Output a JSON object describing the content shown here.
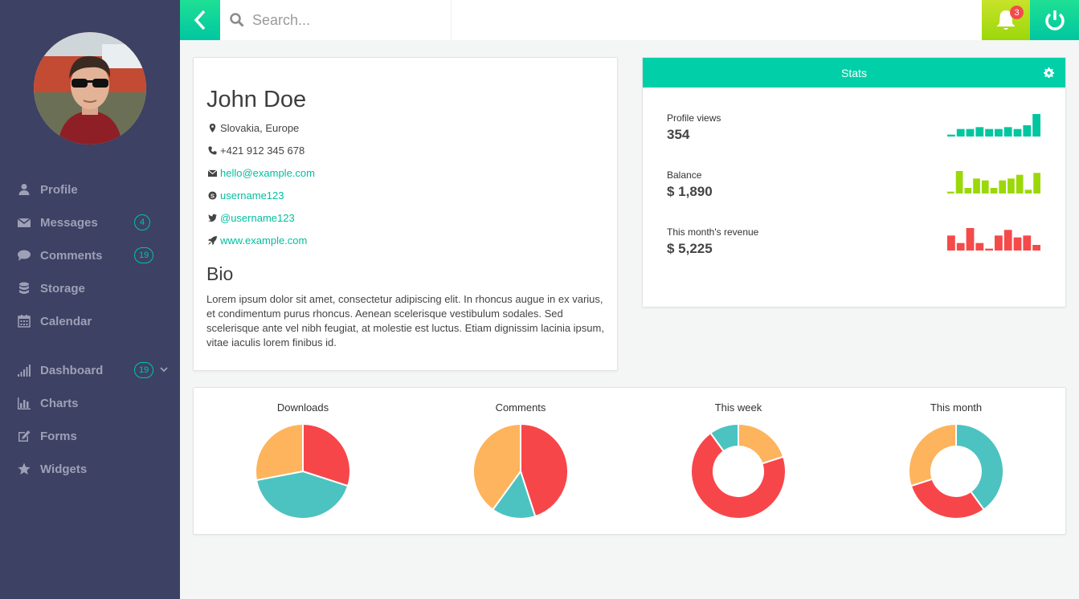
{
  "search": {
    "placeholder": "Search..."
  },
  "notifications": {
    "count": "3"
  },
  "sidebar": {
    "items": [
      {
        "label": "Profile",
        "icon": "user-icon"
      },
      {
        "label": "Messages",
        "icon": "envelope-icon",
        "badge": "4"
      },
      {
        "label": "Comments",
        "icon": "comment-icon",
        "badge": "19"
      },
      {
        "label": "Storage",
        "icon": "database-icon"
      },
      {
        "label": "Calendar",
        "icon": "calendar-icon"
      },
      {
        "label": "Dashboard",
        "icon": "signal-icon",
        "badge": "19"
      },
      {
        "label": "Charts",
        "icon": "bar-chart-icon"
      },
      {
        "label": "Forms",
        "icon": "edit-icon"
      },
      {
        "label": "Widgets",
        "icon": "star-icon"
      }
    ]
  },
  "profile": {
    "name": "John Doe",
    "location": "Slovakia, Europe",
    "phone": "+421 912 345 678",
    "email": "hello@example.com",
    "skype": "username123",
    "twitter": "@username123",
    "website": "www.example.com",
    "bio_title": "Bio",
    "bio": "Lorem ipsum dolor sit amet, consectetur adipiscing elit. In rhoncus augue in ex varius, et condimentum purus rhoncus. Aenean scelerisque vestibulum sodales. Sed scelerisque ante vel nibh feugiat, at molestie est luctus. Etiam dignissim lacinia ipsum, vitae iaculis lorem finibus id."
  },
  "stats": {
    "title": "Stats",
    "items": [
      {
        "label": "Profile views",
        "value": "354",
        "color": "#00c6a0",
        "bars": [
          1,
          4,
          4,
          5,
          4,
          4,
          5,
          4,
          6,
          12
        ]
      },
      {
        "label": "Balance",
        "value": "$ 1,890",
        "color": "#9bd80a",
        "bars": [
          1,
          12,
          3,
          8,
          7,
          3,
          7,
          8,
          10,
          2,
          11
        ]
      },
      {
        "label": "This month's revenue",
        "value": "$ 5,225",
        "color": "#f44a4a",
        "bars": [
          8,
          4,
          12,
          4,
          1,
          8,
          11,
          7,
          8,
          3
        ]
      }
    ]
  },
  "colors": {
    "teal": "#4cc3c0",
    "red": "#f7464a",
    "orange": "#fdb45c",
    "accent": "#00c6a0"
  },
  "pies": [
    {
      "title": "Downloads",
      "donut": false,
      "slices": [
        {
          "value": 30,
          "color": "#f7464a"
        },
        {
          "value": 42,
          "color": "#4cc3c0"
        },
        {
          "value": 28,
          "color": "#fdb45c"
        }
      ]
    },
    {
      "title": "Comments",
      "donut": false,
      "slices": [
        {
          "value": 45,
          "color": "#f7464a"
        },
        {
          "value": 15,
          "color": "#4cc3c0"
        },
        {
          "value": 40,
          "color": "#fdb45c"
        }
      ]
    },
    {
      "title": "This week",
      "donut": true,
      "slices": [
        {
          "value": 20,
          "color": "#fdb45c"
        },
        {
          "value": 70,
          "color": "#f7464a"
        },
        {
          "value": 10,
          "color": "#4cc3c0"
        }
      ]
    },
    {
      "title": "This month",
      "donut": true,
      "slices": [
        {
          "value": 40,
          "color": "#4cc3c0"
        },
        {
          "value": 30,
          "color": "#f7464a"
        },
        {
          "value": 30,
          "color": "#fdb45c"
        }
      ]
    }
  ]
}
